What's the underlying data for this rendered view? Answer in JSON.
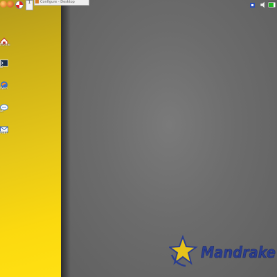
{
  "window_tab": {
    "title": "Configure - Desktop"
  },
  "pager": {
    "label": "1"
  },
  "desktop_icons": [
    {
      "name": "home",
      "label": "Home",
      "color": "#c0392b"
    },
    {
      "name": "terminal",
      "label": "al",
      "color": "#2f4f6f"
    },
    {
      "name": "browser",
      "label": "Web",
      "color": "#2f6fd6"
    },
    {
      "name": "chat",
      "label": "at",
      "color": "#4a7fd4"
    },
    {
      "name": "mail",
      "label": "Mail",
      "color": "#3b66b0"
    }
  ],
  "logo": {
    "text": "Mandrake",
    "text_color": "#2a3d8f",
    "star_color": "#e6c21a"
  },
  "colors": {
    "panel_yellow": "#f6d512",
    "desktop_gray": "#6a6a6a"
  }
}
